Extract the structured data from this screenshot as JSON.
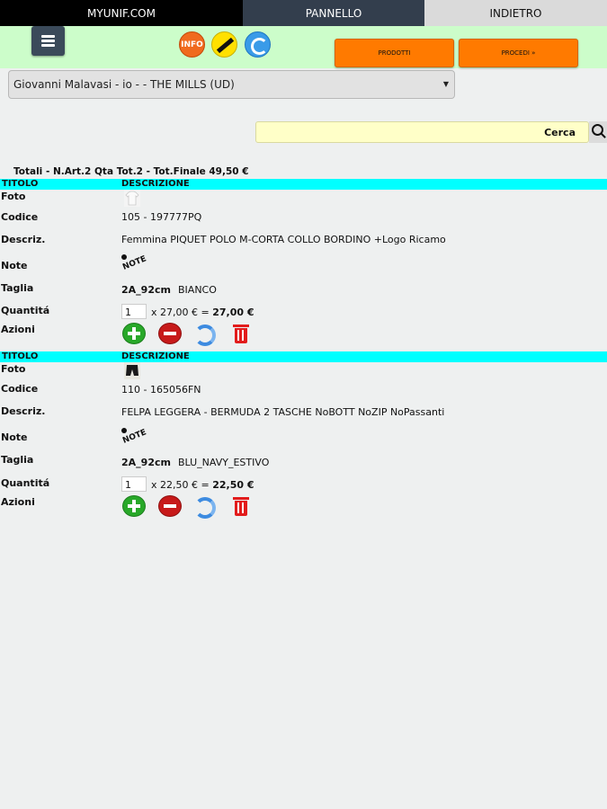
{
  "nav": {
    "tab1": "MYUNIF.COM",
    "tab2": "PANNELLO",
    "tab3": "INDIETRO"
  },
  "toolbar": {
    "info_label": "INFO",
    "btn_products": "PRODOTTI",
    "btn_proceed": "PROCEDI »"
  },
  "customer_select": {
    "value": "Giovanni Malavasi - io - - THE MILLS (UD)"
  },
  "search": {
    "label": "Cerca"
  },
  "totals": "Totali - N.Art.2 Qta Tot.2 - Tot.Finale 49,50 €",
  "labels": {
    "titolo": "TITOLO",
    "descrizione": "DESCRIZIONE",
    "foto": "Foto",
    "codice": "Codice",
    "descriz": "Descriz.",
    "note": "Note",
    "taglia": "Taglia",
    "quantita": "Quantitá",
    "azioni": "Azioni",
    "note_icon_text": "NOTE"
  },
  "items": [
    {
      "codice": "105 - 197777PQ",
      "descriz": "Femmina PIQUET POLO M-CORTA COLLO BORDINO +Logo Ricamo",
      "taglia": "2A_92cm",
      "colore": "BIANCO",
      "qty": "1",
      "price_unit": "x 27,00 € =",
      "price_total": "27,00 €"
    },
    {
      "codice": "110 - 165056FN",
      "descriz": "FELPA LEGGERA - BERMUDA 2 TASCHE NoBOTT NoZIP NoPassanti",
      "taglia": "2A_92cm",
      "colore": "BLU_NAVY_ESTIVO",
      "qty": "1",
      "price_unit": "x 22,50 € =",
      "price_total": "22,50 €"
    }
  ],
  "colors": {
    "accent": "#00ffff",
    "toolbar": "#ccfdca",
    "orange": "#ff7a00",
    "search_bg": "#ffffc8"
  }
}
